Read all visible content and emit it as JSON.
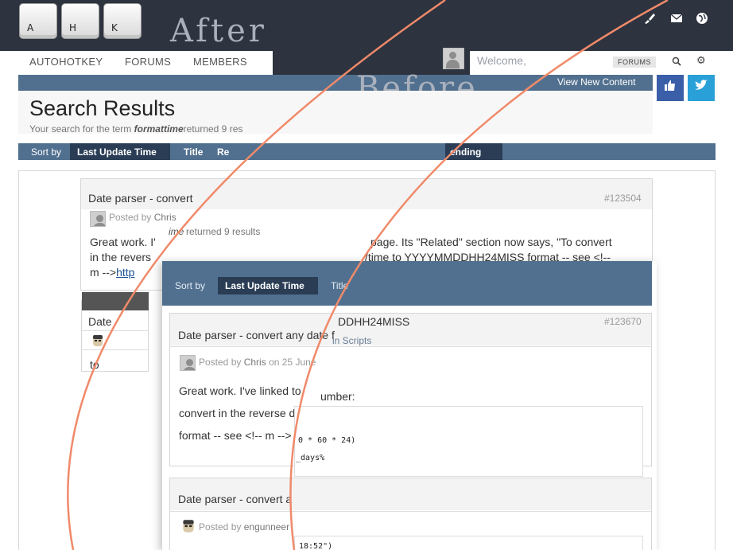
{
  "header": {
    "keys": [
      "A",
      "H",
      "K"
    ],
    "after_label": "After",
    "before_label": "Before",
    "icons": [
      "paintbrush-icon",
      "envelope-icon",
      "globe-icon"
    ]
  },
  "nav": {
    "items": [
      "AUTOHOTKEY",
      "FORUMS",
      "MEMBERS"
    ],
    "welcome": "Welcome,",
    "forums_pill": "FORUMS",
    "view_new_content": "View New Content"
  },
  "search": {
    "title": "Search Results",
    "sub_prefix": "Your search for the term",
    "term": "formattime",
    "sub_suffix": "returned 9 res",
    "overlay_term_tail": "ime",
    "overlay_suffix": "returned 9 results"
  },
  "sortbar": {
    "label": "Sort by",
    "active": "Last Update Time",
    "title": "Title",
    "relevance_stub": "Re",
    "order_tail": "ending"
  },
  "back_results": {
    "r1": {
      "head": "Date parser - convert",
      "id": "#123504",
      "posted_by": "Posted by",
      "author": "Chris",
      "line1_start": "Great work. I'",
      "line1_end": "page. Its \"Related\" section now says, \"To convert",
      "line2_start": "in the revers",
      "line2_end": "/time to YYYYMMDDHH24MISS format -- see <!--",
      "line3_start": "m -->",
      "line3_link": "http"
    },
    "r2": {
      "head": "Date",
      "line": "to"
    }
  },
  "front": {
    "sort_label": "Sort by",
    "active": "Last Update Time",
    "title": "Title",
    "r1": {
      "id_head": "DDHH24MISS",
      "id": "#123670",
      "head": "Date parser - convert any date f",
      "in_scripts": "in Scripts",
      "posted_by": "Posted by",
      "author": "Chris",
      "date": "on 25 June",
      "line1": "Great work. I've linked to",
      "line1_tail": "umber:",
      "line2": "convert in the reverse di",
      "line3": "format -- see <!-- m -->",
      "code1": "0 * 60 * 24)",
      "code2": "_days%"
    },
    "r2": {
      "head": "Date parser - convert a",
      "posted_by": "Posted by",
      "author": "engunneer",
      "code": "18:52\")"
    }
  },
  "colors": {
    "header_dark": "#2d333f",
    "bar_blue": "#51708f",
    "bar_active": "#2a3d55",
    "like_blue": "#3a5ea8",
    "twitter_blue": "#2aa0d8",
    "arc_orange": "#f08a6a"
  }
}
